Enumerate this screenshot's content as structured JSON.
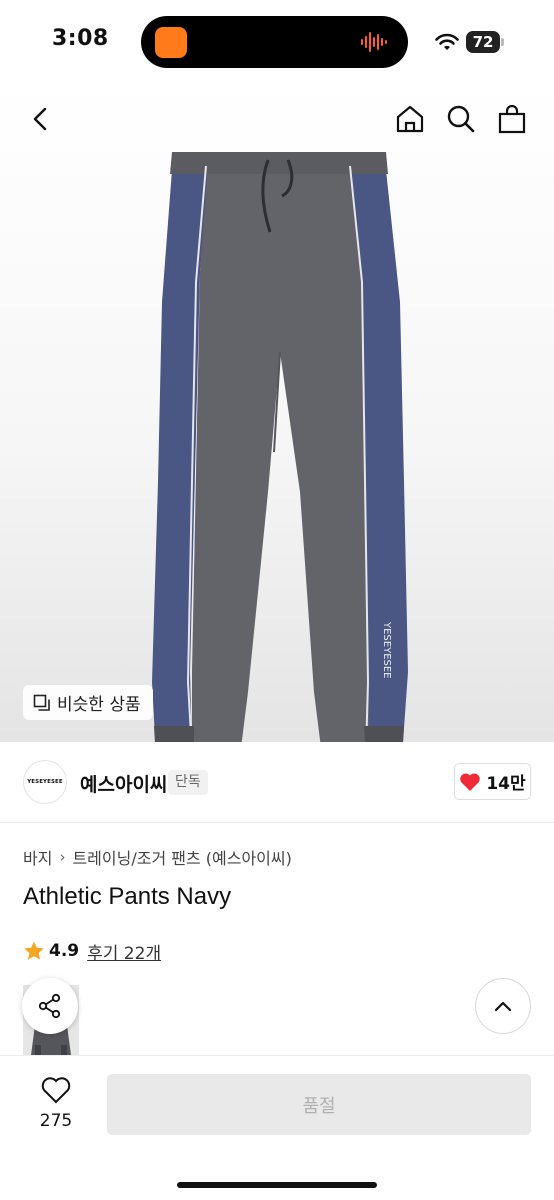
{
  "status_bar": {
    "time": "3:08",
    "battery": "72"
  },
  "colors": {
    "accent_red": "#ee2b36",
    "star": "#f5a623",
    "island_app": "#ff7a1a",
    "pants_gray": "#63636a",
    "pants_navy": "#4a5684"
  },
  "nav": {
    "icons": [
      "back-icon",
      "home-icon",
      "search-icon",
      "shopping-bag-icon"
    ]
  },
  "hero": {
    "similar_label": "비슷한 상품",
    "print_text": "YESEYESEE"
  },
  "brand": {
    "logo_text": "YESEYESEE",
    "name": "예스아이씨",
    "tag": "단독",
    "likes": "14만"
  },
  "breadcrumb": {
    "category": "바지",
    "subcategory": "트레이닝/조거 팬츠 (예스아이씨)"
  },
  "product": {
    "title": "Athletic Pants Navy",
    "rating": "4.9",
    "reviews": "후기 22개"
  },
  "bottom": {
    "wish_count": "275",
    "buy_label": "품절"
  }
}
